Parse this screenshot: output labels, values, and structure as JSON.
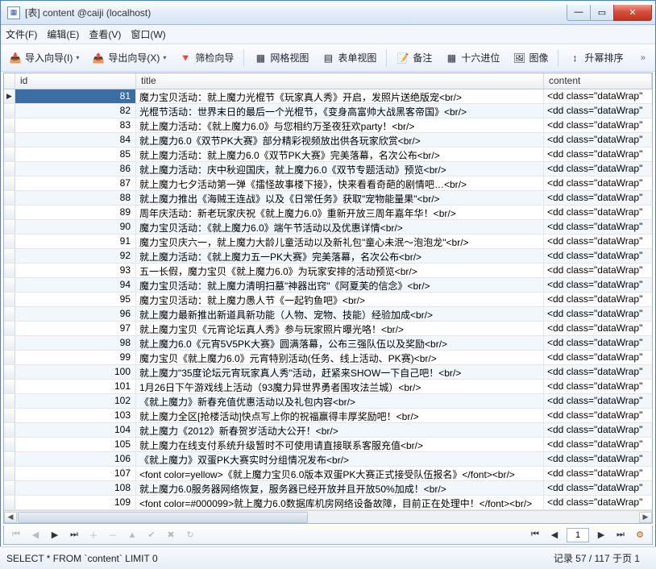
{
  "window": {
    "title": "[表] content @caiji (localhost)"
  },
  "menu": {
    "file": "文件(F)",
    "edit": "编辑(E)",
    "view": "查看(V)",
    "window": "窗口(W)"
  },
  "toolbar": {
    "import_wizard": "导入向导(I)",
    "export_wizard": "导出向导(X)",
    "filter_wizard": "筛检向导",
    "grid_view": "网格视图",
    "form_view": "表单视图",
    "memo": "备注",
    "hex": "十六进位",
    "image": "图像",
    "sort_asc": "升幂排序"
  },
  "columns": {
    "id": "id",
    "title": "title",
    "content": "content"
  },
  "rows": [
    {
      "id": "81",
      "title": "魔力宝贝活动：就上魔力光棍节《玩家真人秀》开启，发照片送绝版宠<br/>",
      "content": "<dd class=\"dataWrap\""
    },
    {
      "id": "82",
      "title": "光棍节活动：世界末日的最后一个光棍节，《变身高富帅大战黑客帝国》<br/>",
      "content": "<dd class=\"dataWrap\""
    },
    {
      "id": "83",
      "title": "就上魔力活动：《就上魔力6.0》与您相约万圣夜狂欢party！<br/>",
      "content": "<dd class=\"dataWrap\""
    },
    {
      "id": "84",
      "title": "就上魔力6.0《双节PK大赛》部分精彩视频放出供各玩家欣赏<br/>",
      "content": "<dd class=\"dataWrap\""
    },
    {
      "id": "85",
      "title": "就上魔力活动：就上魔力6.0《双节PK大赛》完美落幕，名次公布<br/>",
      "content": "<dd class=\"dataWrap\""
    },
    {
      "id": "86",
      "title": "就上魔力活动：庆中秋迎国庆，就上魔力6.0《双节专题活动》预览<br/>",
      "content": "<dd class=\"dataWrap\""
    },
    {
      "id": "87",
      "title": "就上魔力七夕活动第一弹《擂怪故事楼下接》，快来看看奇葩的剧情吧…<br/>",
      "content": "<dd class=\"dataWrap\""
    },
    {
      "id": "88",
      "title": "就上魔力推出《海贼王连战》以及《日常任务》获取\"宠物能量果\"<br/>",
      "content": "<dd class=\"dataWrap\""
    },
    {
      "id": "89",
      "title": "周年庆活动：新老玩家庆祝《就上魔力6.0》重新开放三周年嘉年华！<br/>",
      "content": "<dd class=\"dataWrap\""
    },
    {
      "id": "90",
      "title": "魔力宝贝活动：《就上魔力6.0》端午节活动以及优惠详情<br/>",
      "content": "<dd class=\"dataWrap\""
    },
    {
      "id": "91",
      "title": "魔力宝贝庆六一，就上魔力大龄儿童活动以及新礼包\"童心未泯～泡泡龙\"<br/>",
      "content": "<dd class=\"dataWrap\""
    },
    {
      "id": "92",
      "title": "就上魔力活动：《就上魔力五一PK大赛》完美落幕，名次公布<br/>",
      "content": "<dd class=\"dataWrap\""
    },
    {
      "id": "93",
      "title": "五一长假，魔力宝贝《就上魔力6.0》为玩家安排的活动预览<br/>",
      "content": "<dd class=\"dataWrap\""
    },
    {
      "id": "94",
      "title": "魔力宝贝活动：就上魔力清明扫墓\"神器出窍\"《阿夏芙的信念》<br/>",
      "content": "<dd class=\"dataWrap\""
    },
    {
      "id": "95",
      "title": "魔力宝贝活动：就上魔力愚人节《一起钓鱼吧》<br/>",
      "content": "<dd class=\"dataWrap\""
    },
    {
      "id": "96",
      "title": "就上魔力最新推出新道具新功能（人物、宠物、技能）经验加成<br/>",
      "content": "<dd class=\"dataWrap\""
    },
    {
      "id": "97",
      "title": "就上魔力宝贝《元宵论坛真人秀》参与玩家照片曝光咯！<br/>",
      "content": "<dd class=\"dataWrap\""
    },
    {
      "id": "98",
      "title": "就上魔力6.0《元宵5V5PK大赛》圆满落幕，公布三强队伍以及奖励<br/>",
      "content": "<dd class=\"dataWrap\""
    },
    {
      "id": "99",
      "title": "魔力宝贝《就上魔力6.0》元宵特别活动(任务、线上活动、PK赛)<br/>",
      "content": "<dd class=\"dataWrap\""
    },
    {
      "id": "100",
      "title": "就上魔力\"35度论坛元宵玩家真人秀\"活动，赶紧来SHOW一下自己吧！<br/>",
      "content": "<dd class=\"dataWrap\""
    },
    {
      "id": "101",
      "title": "1月26日下午游戏线上活动（93魔力异世界勇者围攻法兰城）<br/>",
      "content": "<dd class=\"dataWrap\""
    },
    {
      "id": "102",
      "title": "《就上魔力》新春充值优惠活动以及礼包内容<br/>",
      "content": "<dd class=\"dataWrap\""
    },
    {
      "id": "103",
      "title": "就上魔力全区[抢楼活动]快点写上你的祝福赢得丰厚奖励吧！<br/>",
      "content": "<dd class=\"dataWrap\""
    },
    {
      "id": "104",
      "title": "就上魔力《2012》新春贺岁活动大公开！<br/>",
      "content": "<dd class=\"dataWrap\""
    },
    {
      "id": "105",
      "title": "就上魔力在线支付系统升级暂时不可使用请直接联系客服充值<br/>",
      "content": "<dd class=\"dataWrap\""
    },
    {
      "id": "106",
      "title": "《就上魔力》双蛋PK大赛实时分组情况发布<br/>",
      "content": "<dd class=\"dataWrap\""
    },
    {
      "id": "107",
      "title": "<font color=yellow>《就上魔力宝贝6.0版本双蛋PK大赛正式接受队伍报名》</font><br/>",
      "content": "<dd class=\"dataWrap\""
    },
    {
      "id": "108",
      "title": "就上魔力6.0服务器网络恢复，服务器已经开放并且开放50%加成！<br/>",
      "content": "<dd class=\"dataWrap\""
    },
    {
      "id": "109",
      "title": "<font color=#000099>就上魔力6.0数据库机房网络设备故障，目前正在处理中！</font><br/>",
      "content": "<dd class=\"dataWrap\""
    }
  ],
  "nav": {
    "page_value": "1"
  },
  "status": {
    "query": "SELECT * FROM `content` LIMIT 0",
    "record": "记录 57 / 117 于页 1"
  },
  "colors": {
    "selected_bg": "#3b6ea5"
  }
}
